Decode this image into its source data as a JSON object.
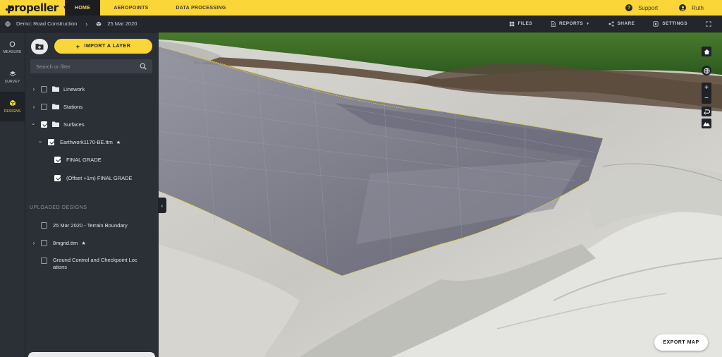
{
  "topbar": {
    "logo_text": "propeller",
    "tabs": [
      {
        "label": "HOME",
        "active": true
      },
      {
        "label": "AEROPOINTS",
        "active": false
      },
      {
        "label": "DATA PROCESSING",
        "active": false
      }
    ],
    "support_label": "Support",
    "user_name": "Ruth"
  },
  "subbar": {
    "project_name": "Demo: Road Construction",
    "survey_date": "25 Mar 2020",
    "actions": {
      "files": "FILES",
      "reports": "REPORTS",
      "share": "SHARE",
      "settings": "SETTINGS"
    }
  },
  "rail": {
    "items": [
      {
        "label": "MEASURE",
        "icon": "measure-icon",
        "active": false
      },
      {
        "label": "SURVEY",
        "icon": "layers-icon",
        "active": false
      },
      {
        "label": "DESIGNS",
        "icon": "cube-icon",
        "active": true
      }
    ]
  },
  "panel": {
    "import_label": "IMPORT A LAYER",
    "search_placeholder": "Search or filter",
    "tree": [
      {
        "label": "Linework",
        "expanded": false,
        "checked": false,
        "folder": true
      },
      {
        "label": "Stations",
        "expanded": false,
        "checked": false,
        "folder": true
      },
      {
        "label": "Surfaces",
        "expanded": true,
        "checked": true,
        "folder": true
      },
      {
        "label": "Earthwork1170-BE.ttm",
        "expanded": true,
        "checked": true,
        "folder": false,
        "starred": true
      },
      {
        "label": "FINAL GRADE",
        "checked": true
      },
      {
        "label": "(Offset +1m) FINAL GRADE",
        "checked": true
      }
    ],
    "uploaded_heading": "UPLOADED DESIGNS",
    "uploaded": [
      {
        "label": "25 Mar 2020 - Terrain Boundary",
        "checked": false
      },
      {
        "label": "8mgrid.ttm",
        "checked": false,
        "starred": true,
        "expandable": true
      },
      {
        "label_line1": "Ground Control and Checkpoint Loc",
        "label_line2": "ations",
        "checked": false
      }
    ]
  },
  "map": {
    "export_label": "EXPORT MAP"
  },
  "colors": {
    "brand_yellow": "#fad638",
    "panel_bg": "#2b2f36",
    "header_dark": "#23262c"
  }
}
